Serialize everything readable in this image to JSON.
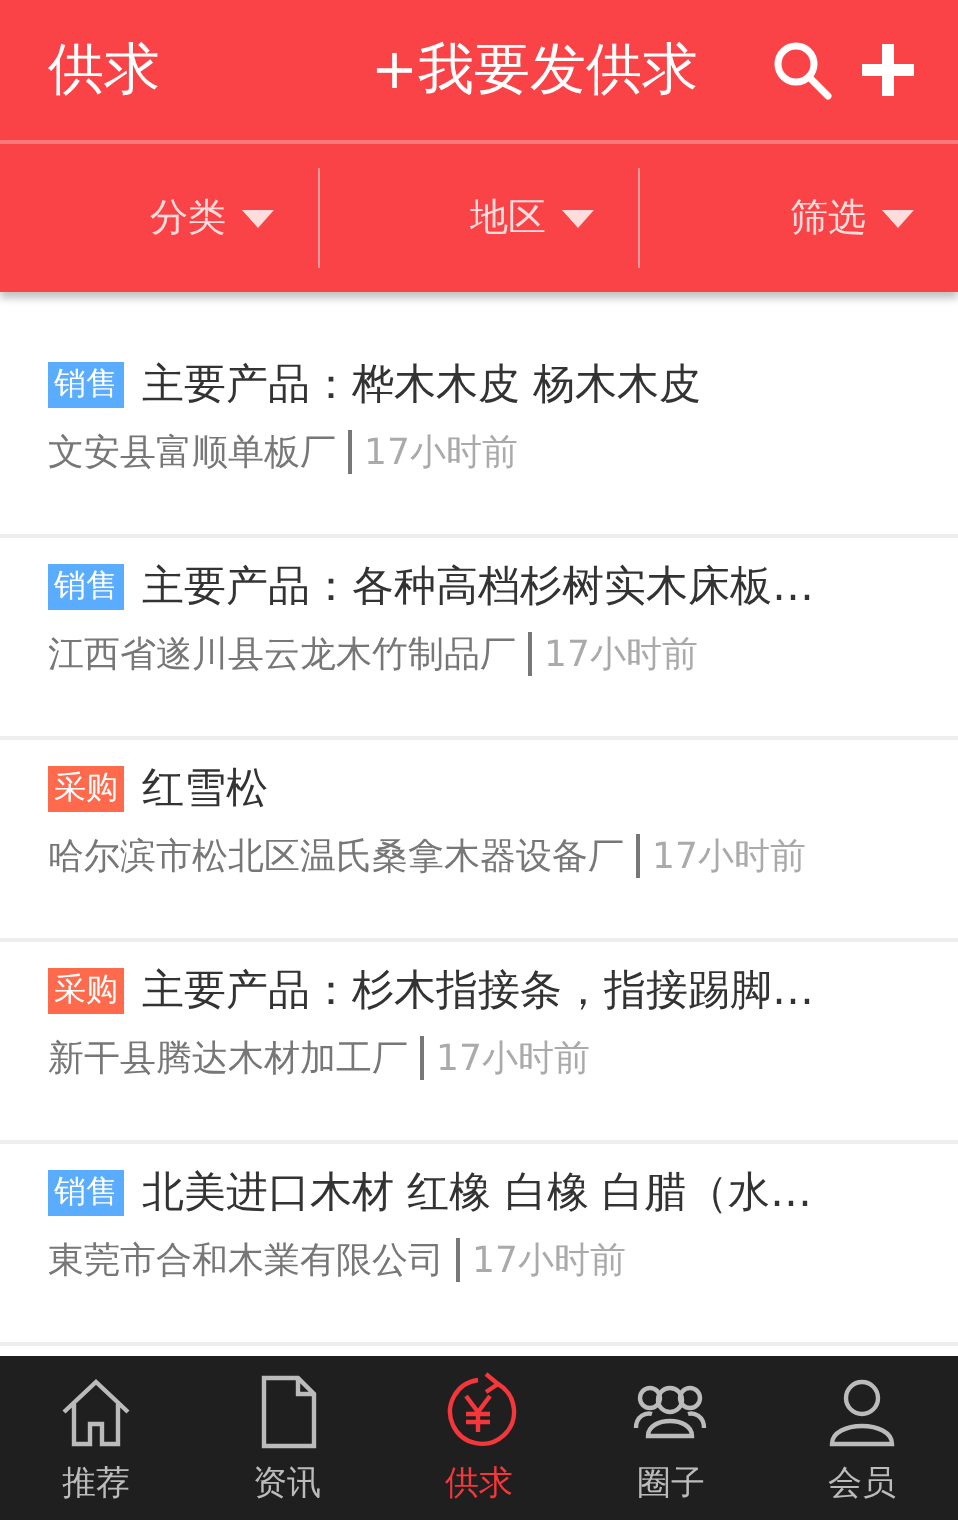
{
  "header": {
    "title": "供求",
    "post_button": "+我要发供求"
  },
  "filters": [
    {
      "label": "分类"
    },
    {
      "label": "地区"
    },
    {
      "label": "筛选"
    }
  ],
  "listings": [
    {
      "kind": "sell",
      "tag": "销售",
      "title": "主要产品：桦木木皮 杨木木皮",
      "company": "文安县富顺单板厂",
      "time": "17小时前"
    },
    {
      "kind": "sell",
      "tag": "销售",
      "title": "主要产品：各种高档杉树实木床板…",
      "company": "江西省遂川县云龙木竹制品厂",
      "time": "17小时前"
    },
    {
      "kind": "buy",
      "tag": "采购",
      "title": "红雪松",
      "company": "哈尔滨市松北区温氏桑拿木器设备厂",
      "time": "17小时前"
    },
    {
      "kind": "buy",
      "tag": "采购",
      "title": "主要产品：杉木指接条，指接踢脚…",
      "company": "新干县腾达木材加工厂",
      "time": "17小时前"
    },
    {
      "kind": "sell",
      "tag": "销售",
      "title": "北美进口木材 红橡 白橡 白腊（水…",
      "company": "東莞市合和木業有限公司",
      "time": "17小时前"
    }
  ],
  "tab_bar": [
    {
      "kind": "home",
      "label": "推荐",
      "selected": false
    },
    {
      "kind": "document",
      "label": "资讯",
      "selected": false
    },
    {
      "kind": "yen",
      "label": "供求",
      "selected": true
    },
    {
      "kind": "group",
      "label": "圈子",
      "selected": false
    },
    {
      "kind": "person",
      "label": "会员",
      "selected": false
    }
  ]
}
